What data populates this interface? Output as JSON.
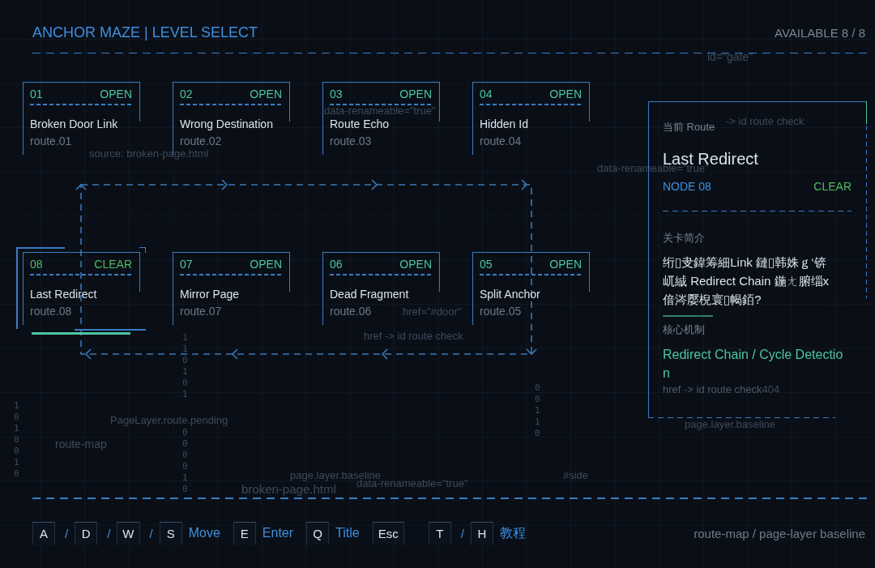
{
  "header": {
    "title": "ANCHOR MAZE | LEVEL SELECT",
    "available": "AVAILABLE 8 / 8"
  },
  "level_rows": [
    {
      "levels": [
        {
          "number": "01",
          "status": "OPEN",
          "cleared": false,
          "selected": false,
          "title": "Broken Door Link",
          "route": "route.01"
        },
        {
          "number": "02",
          "status": "OPEN",
          "cleared": false,
          "selected": false,
          "title": "Wrong Destination",
          "route": "route.02"
        },
        {
          "number": "03",
          "status": "OPEN",
          "cleared": false,
          "selected": false,
          "title": "Route Echo",
          "route": "route.03"
        },
        {
          "number": "04",
          "status": "OPEN",
          "cleared": false,
          "selected": false,
          "title": "Hidden Id",
          "route": "route.04"
        }
      ]
    },
    {
      "levels": [
        {
          "number": "08",
          "status": "CLEAR",
          "cleared": true,
          "selected": true,
          "title": "Last Redirect",
          "route": "route.08"
        },
        {
          "number": "07",
          "status": "OPEN",
          "cleared": false,
          "selected": false,
          "title": "Mirror Page",
          "route": "route.07"
        },
        {
          "number": "06",
          "status": "OPEN",
          "cleared": false,
          "selected": false,
          "title": "Dead Fragment",
          "route": "route.06"
        },
        {
          "number": "05",
          "status": "OPEN",
          "cleared": false,
          "selected": false,
          "title": "Split Anchor",
          "route": "route.05"
        }
      ]
    }
  ],
  "detail": {
    "label": "当前 Route",
    "title": "Last Redirect",
    "node": "NODE 08",
    "status": "CLEAR",
    "cleared": true,
    "intro_label": "关卡简介",
    "intro": "绗▯叏鍏筹細Link 鏈▯韩姝ｇ‘锛屼絾 Redirect Chain 鍦ㄤ腑缁х偣涔嬮棿寰▯幆銆?",
    "mechanic_label": "核心机制",
    "mechanic": "Redirect Chain / Cycle Detection",
    "note": "href -> id route check",
    "note_code": "404"
  },
  "background_texts": [
    "id=\"gate\"",
    "data-renameable=\"true\"",
    "source: broken-page.html",
    "-> id route check",
    "data-renameable=\"true\"",
    "href=\"#door\"",
    "href -> id route check",
    "PageLayer.route.pending",
    "route-map",
    "page.layer.baseline",
    "data-renameable=\"true\"",
    "#side",
    "broken-page.html",
    "page.layer.baseline"
  ],
  "binary_columns": [
    "110101",
    "000010",
    "00110",
    "1010010"
  ],
  "controls": [
    {
      "kind": "key",
      "text": "A"
    },
    {
      "kind": "slash",
      "text": "/"
    },
    {
      "kind": "key",
      "text": "D"
    },
    {
      "kind": "slash",
      "text": "/"
    },
    {
      "kind": "key",
      "text": "W"
    },
    {
      "kind": "slash",
      "text": "/"
    },
    {
      "kind": "key",
      "text": "S"
    },
    {
      "kind": "action",
      "text": "Move"
    },
    {
      "kind": "key",
      "text": "E"
    },
    {
      "kind": "action",
      "text": "Enter"
    },
    {
      "kind": "key",
      "text": "Q"
    },
    {
      "kind": "action",
      "text": "Title"
    },
    {
      "kind": "key",
      "text": "Esc"
    },
    {
      "kind": "key",
      "text": "T"
    },
    {
      "kind": "slash",
      "text": "/"
    },
    {
      "kind": "key",
      "text": "H"
    },
    {
      "kind": "action",
      "text": "教程"
    }
  ],
  "footer_note": "route-map / page-layer baseline"
}
